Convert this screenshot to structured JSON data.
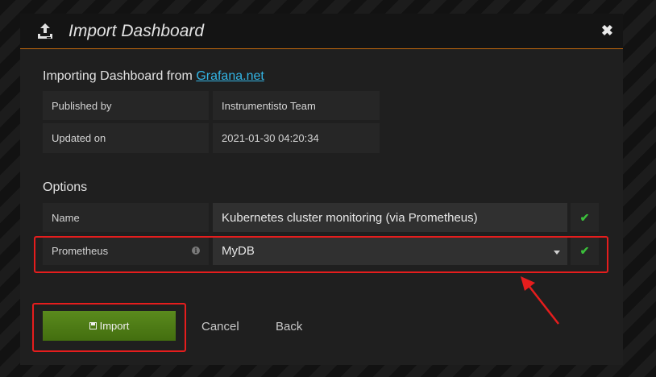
{
  "modal": {
    "title": "Import Dashboard",
    "close_icon": "close-icon",
    "header_icon": "upload-icon"
  },
  "intro": {
    "prefix": "Importing Dashboard from ",
    "link": "Grafana.net"
  },
  "info": [
    {
      "label": "Published by",
      "value": "Instrumentisto Team"
    },
    {
      "label": "Updated on",
      "value": "2021-01-30 04:20:34"
    }
  ],
  "options": {
    "title": "Options",
    "name_label": "Name",
    "name_value": "Kubernetes cluster monitoring (via Prometheus)",
    "prometheus_label": "Prometheus",
    "prometheus_value": "MyDB"
  },
  "actions": {
    "import": "Import",
    "cancel": "Cancel",
    "back": "Back"
  },
  "colors": {
    "accent": "#c2690e",
    "link": "#33b5e5",
    "import_button": "#4e7d17",
    "check": "#3bbf3b",
    "highlight": "#e51d1d"
  }
}
